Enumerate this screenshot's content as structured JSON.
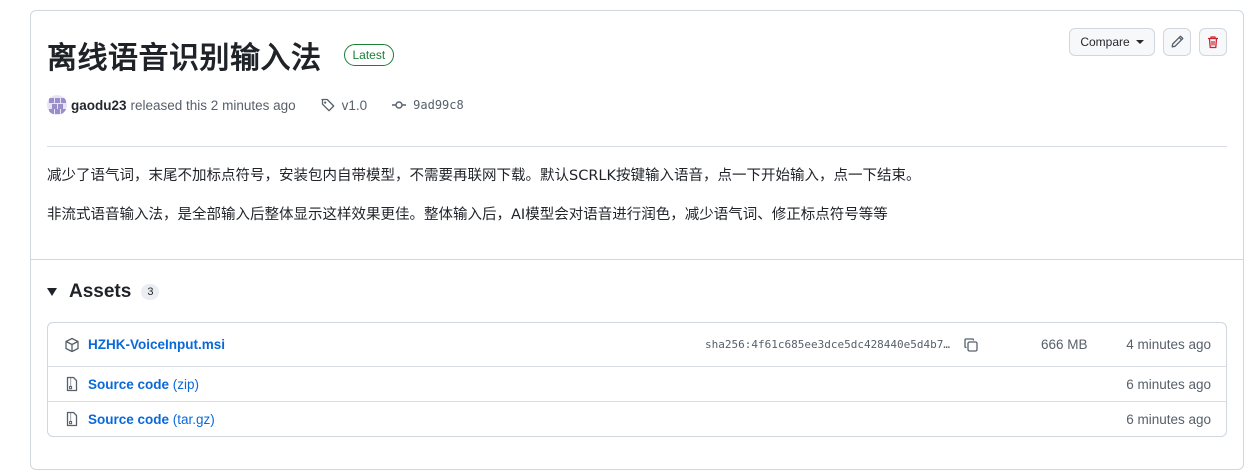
{
  "release": {
    "title": "离线语音识别输入法",
    "latest_badge": "Latest",
    "author": "gaodu23",
    "released_text": "released this 2 minutes ago",
    "tag": "v1.0",
    "commit": "9ad99c8"
  },
  "actions": {
    "compare_label": "Compare",
    "edit_icon": "pencil-icon",
    "delete_icon": "trash-icon"
  },
  "description": [
    "减少了语气词，末尾不加标点符号，安装包内自带模型，不需要再联网下载。默认SCRLK按键输入语音，点一下开始输入，点一下结束。",
    "非流式语音输入法，是全部输入后整体显示这样效果更佳。整体输入后，AI模型会对语音进行润色，减少语气词、修正标点符号等等"
  ],
  "assets": {
    "title": "Assets",
    "count": "3",
    "items": [
      {
        "name": "HZHK-VoiceInput.msi",
        "ext": "",
        "sha": "sha256:4f61c685ee3dce5dc428440e5d4b7…",
        "size": "666 MB",
        "time": "4 minutes ago",
        "icon": "package-icon"
      },
      {
        "name": "Source code",
        "ext": "(zip)",
        "sha": "",
        "size": "",
        "time": "6 minutes ago",
        "icon": "file-zip-icon"
      },
      {
        "name": "Source code",
        "ext": "(tar.gz)",
        "sha": "",
        "size": "",
        "time": "6 minutes ago",
        "icon": "file-zip-icon"
      }
    ]
  },
  "colors": {
    "accent_link": "#0969da",
    "latest_green": "#1a7f37",
    "delete_red": "#cf222e"
  }
}
